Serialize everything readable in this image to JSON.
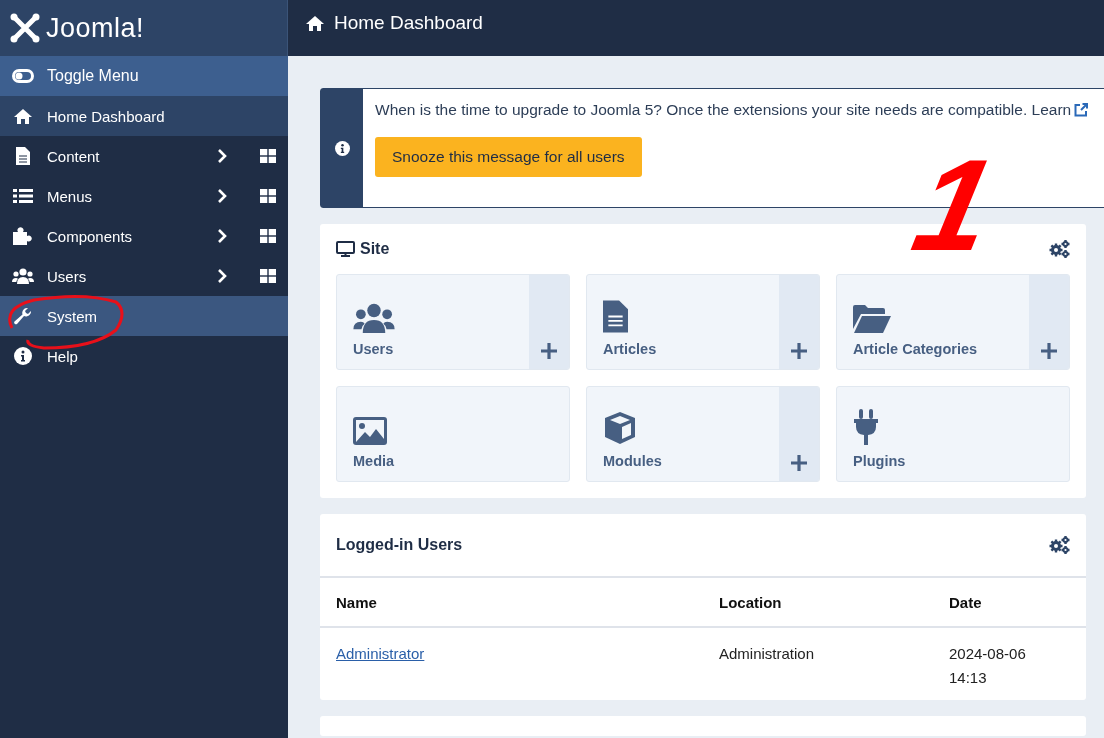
{
  "sidebar": {
    "logo": "Joomla!",
    "items": [
      {
        "label": "Toggle Menu",
        "kind": "toggle",
        "selected": false,
        "hovered": false
      },
      {
        "label": "Home Dashboard",
        "kind": "link",
        "selected": true,
        "hovered": false
      },
      {
        "label": "Content",
        "kind": "submenu",
        "selected": false,
        "hovered": false
      },
      {
        "label": "Menus",
        "kind": "submenu",
        "selected": false,
        "hovered": false
      },
      {
        "label": "Components",
        "kind": "submenu",
        "selected": false,
        "hovered": false
      },
      {
        "label": "Users",
        "kind": "submenu",
        "selected": false,
        "hovered": false
      },
      {
        "label": "System",
        "kind": "link",
        "selected": false,
        "hovered": true
      },
      {
        "label": "Help",
        "kind": "link",
        "selected": false,
        "hovered": false
      }
    ]
  },
  "header": {
    "title": "Home Dashboard"
  },
  "banner": {
    "message": "When is the time to upgrade to Joomla 5? Once the extensions your site needs are compatible. Learn",
    "button": "Snooze this message for all users"
  },
  "site": {
    "title": "Site",
    "tiles": [
      {
        "label": "Users",
        "add": true
      },
      {
        "label": "Articles",
        "add": true
      },
      {
        "label": "Article Categories",
        "add": true
      },
      {
        "label": "Media",
        "add": false
      },
      {
        "label": "Modules",
        "add": true
      },
      {
        "label": "Plugins",
        "add": false
      }
    ]
  },
  "logged_in_users": {
    "title": "Logged-in Users",
    "columns": [
      "Name",
      "Location",
      "Date"
    ],
    "rows": [
      {
        "name": "Administrator",
        "location": "Administration",
        "date": "2024-08-06 14:13"
      }
    ]
  },
  "annotations": [
    {
      "kind": "number",
      "text": "1"
    },
    {
      "kind": "ellipse"
    }
  ]
}
